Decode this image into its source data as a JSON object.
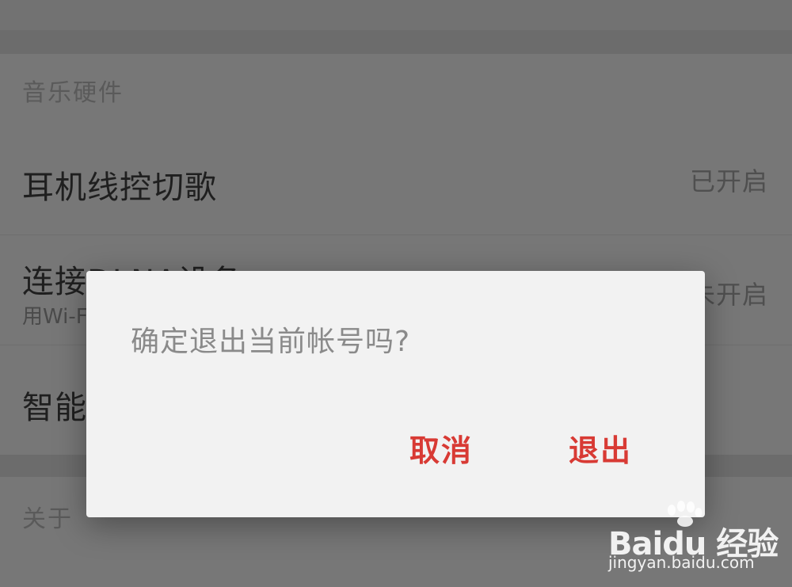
{
  "settings": {
    "section_music_hardware": "音乐硬件",
    "headset_control": {
      "title": "耳机线控切歌",
      "status": "已开启"
    },
    "dlna": {
      "title": "连接DLNA设备",
      "subtitle": "用Wi-Fi",
      "status": "未开启"
    },
    "smart_row": {
      "title": "智能"
    },
    "section_about": "关于"
  },
  "dialog": {
    "message": "确定退出当前帐号吗?",
    "cancel_label": "取消",
    "exit_label": "退出"
  },
  "watermark": {
    "logo_text": "Baidu 经验",
    "url": "jingyan.baidu.com"
  },
  "colors": {
    "accent": "#d83a34",
    "dialog_bg": "#f2f2f2",
    "overlay": "#777777"
  }
}
